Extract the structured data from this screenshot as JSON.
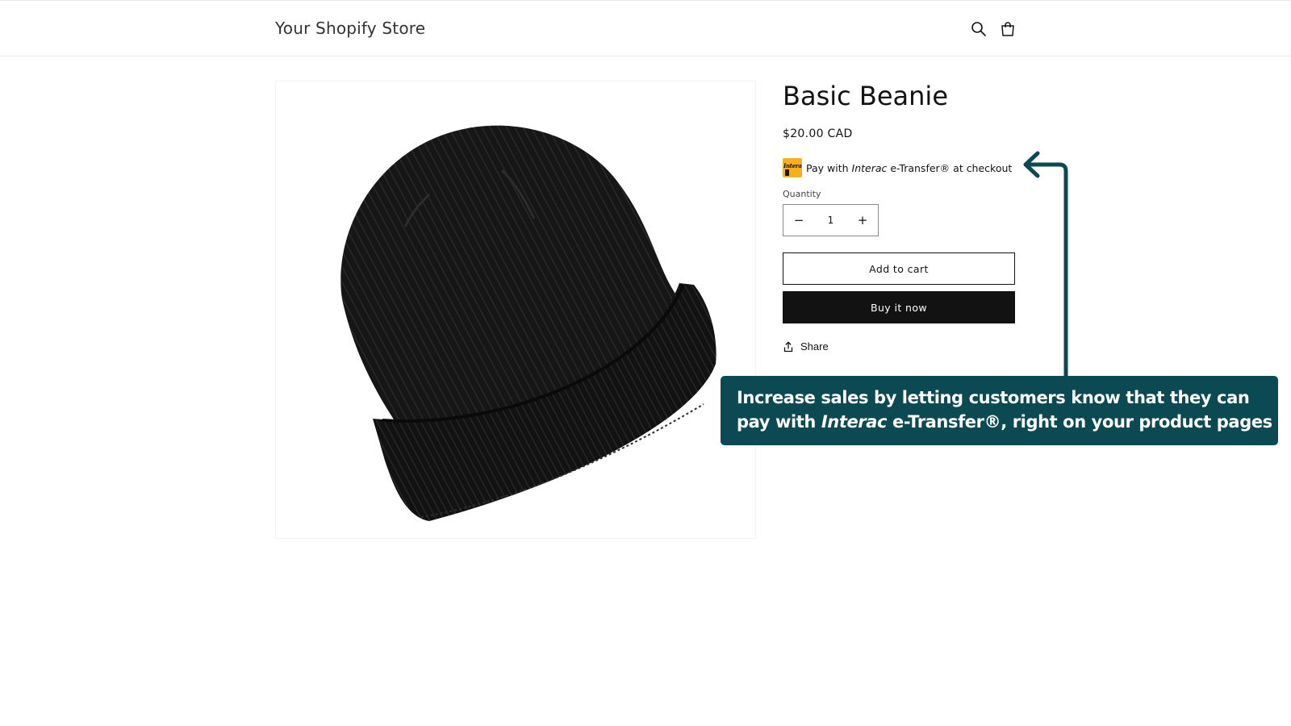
{
  "header": {
    "store_title": "Your Shopify Store",
    "icons": [
      "search-icon",
      "cart-icon"
    ]
  },
  "product": {
    "title": "Basic Beanie",
    "price": "$20.00 CAD",
    "image_icon": "beanie-image"
  },
  "interac": {
    "logo_text": "Interac",
    "text_before": "Pay with ",
    "text_brand": "Interac",
    "text_after": " e-Transfer® at checkout"
  },
  "quantity": {
    "label": "Quantity",
    "value": "1",
    "minus": "−",
    "plus": "+"
  },
  "buttons": {
    "add_to_cart": "Add to cart",
    "buy_now": "Buy it now"
  },
  "share": {
    "label": "Share",
    "icon": "share-icon"
  },
  "callout": {
    "line1": "Increase sales by letting customers know that they can",
    "line2_before": "pay with ",
    "line2_brand": "Interac",
    "line2_after": " e-Transfer®, right on your product pages"
  },
  "colors": {
    "callout_bg": "#0b4a52",
    "button_dark": "#121212",
    "interac_yellow": "#f6b01d"
  }
}
